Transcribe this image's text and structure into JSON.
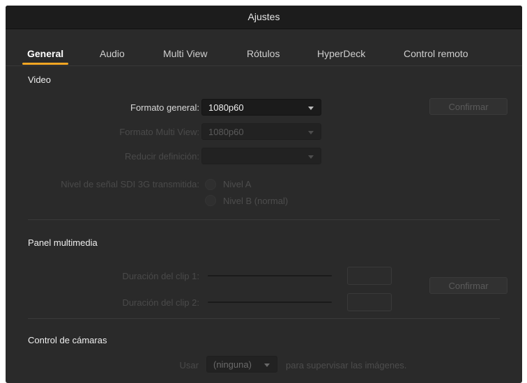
{
  "window": {
    "title": "Ajustes"
  },
  "tabs": [
    {
      "label": "General",
      "active": true
    },
    {
      "label": "Audio"
    },
    {
      "label": "Multi View"
    },
    {
      "label": "Rótulos"
    },
    {
      "label": "HyperDeck"
    },
    {
      "label": "Control remoto"
    }
  ],
  "video": {
    "section_title": "Video",
    "general_format": {
      "label": "Formato general:",
      "value": "1080p60"
    },
    "multiview_format": {
      "label": "Formato Multi View:",
      "value": "1080p60"
    },
    "downconvert": {
      "label": "Reducir definición:",
      "value": ""
    },
    "sdi_level": {
      "label": "Nivel de señal SDI 3G transmitida:",
      "options": [
        "Nivel A",
        "Nivel B (normal)"
      ]
    },
    "confirm_label": "Confirmar"
  },
  "media": {
    "section_title": "Panel multimedia",
    "clip1_label": "Duración del clip 1:",
    "clip2_label": "Duración del clip 2:",
    "confirm_label": "Confirmar"
  },
  "camera": {
    "section_title": "Control de cámaras",
    "use_label": "Usar",
    "select_value": "(ninguna)",
    "suffix": "para supervisar las imágenes."
  },
  "colors": {
    "accent": "#f5a623",
    "background": "#2a2a2a",
    "titlebar": "#1c1c1c"
  }
}
